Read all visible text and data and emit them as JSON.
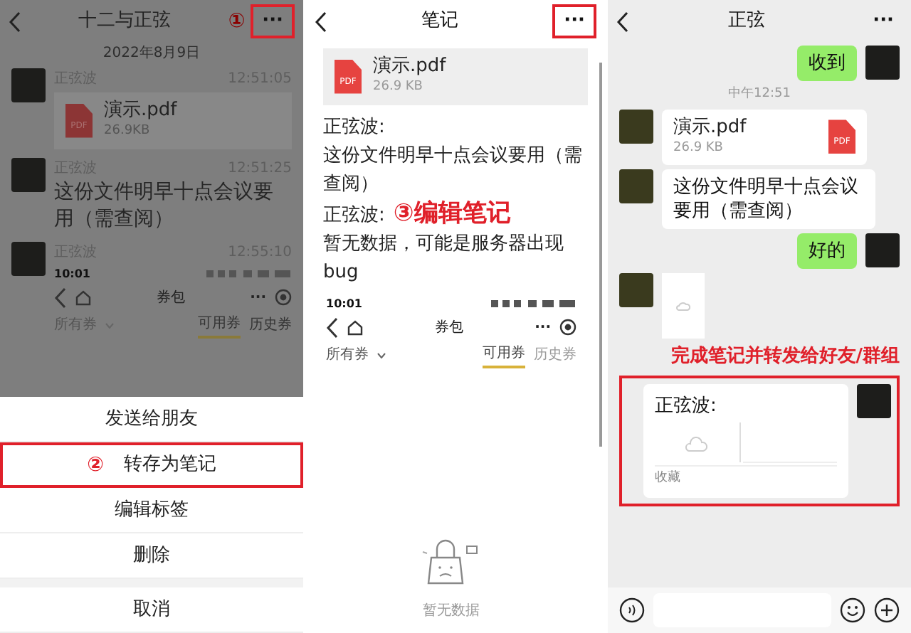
{
  "favorites_screen": {
    "header": {
      "title": "十二与正弦",
      "step_marker": "①",
      "more_button": "···",
      "annotated": true
    },
    "date": "2022年8月9日",
    "messages": [
      {
        "kind": "file",
        "sender": "正弦波",
        "time": "12:51:05",
        "file_name": "演示.pdf",
        "file_size": "26.9KB",
        "icon_label": "PDF"
      },
      {
        "kind": "text",
        "sender": "正弦波",
        "time": "12:51:25",
        "text": "这份文件明早十点会议要用（需查阅）"
      },
      {
        "kind": "screenshot",
        "sender": "正弦波",
        "time": "12:55:10",
        "shot": {
          "status_time": "10:01",
          "title": "券包",
          "more": "···",
          "filter": "所有券",
          "tabs": [
            {
              "label": "可用券",
              "selected": true
            },
            {
              "label": "历史券",
              "selected": false
            }
          ]
        }
      }
    ],
    "action_sheet": {
      "items": [
        {
          "label": "发送给朋友",
          "highlighted": false
        },
        {
          "label": "转存为笔记",
          "highlighted": true,
          "step_marker": "②"
        },
        {
          "label": "编辑标签",
          "highlighted": false
        },
        {
          "label": "删除",
          "highlighted": false
        }
      ],
      "cancel": "取消"
    }
  },
  "note_screen": {
    "header": {
      "title": "笔记",
      "more_button": "···",
      "annotated": true
    },
    "file": {
      "file_name": "演示.pdf",
      "file_size": "26.9 KB",
      "icon_label": "PDF"
    },
    "lines": [
      {
        "text": "正弦波:"
      },
      {
        "text": "这份文件明早十点会议要用（需查阅）"
      },
      {
        "text": "正弦波:",
        "annotation": "③编辑笔记"
      },
      {
        "text": "暂无数据，可能是服务器出现bug"
      }
    ],
    "shot": {
      "status_time": "10:01",
      "title": "券包",
      "more": "···",
      "filter": "所有券",
      "tabs": [
        {
          "label": "可用券",
          "selected": true
        },
        {
          "label": "历史券",
          "selected": false
        }
      ],
      "empty_text": "暂无数据"
    }
  },
  "chat_screen": {
    "header": {
      "title": "正弦",
      "more_button": "···",
      "annotated": false
    },
    "messages": [
      {
        "kind": "text",
        "outgoing": true,
        "text": "收到"
      },
      {
        "kind": "time",
        "text": "中午12:51"
      },
      {
        "kind": "file",
        "outgoing": false,
        "file_name": "演示.pdf",
        "file_size": "26.9 KB",
        "icon_label": "PDF"
      },
      {
        "kind": "text",
        "outgoing": false,
        "text": "这份文件明早十点会议要用（需查阅）"
      },
      {
        "kind": "text",
        "outgoing": true,
        "text": "好的"
      },
      {
        "kind": "screenshot",
        "outgoing": false
      },
      {
        "kind": "caption",
        "text": "完成笔记并转发给好友/群组"
      },
      {
        "kind": "note",
        "outgoing": true,
        "annotated": true,
        "title": "正弦波:",
        "footer": "收藏"
      }
    ]
  }
}
